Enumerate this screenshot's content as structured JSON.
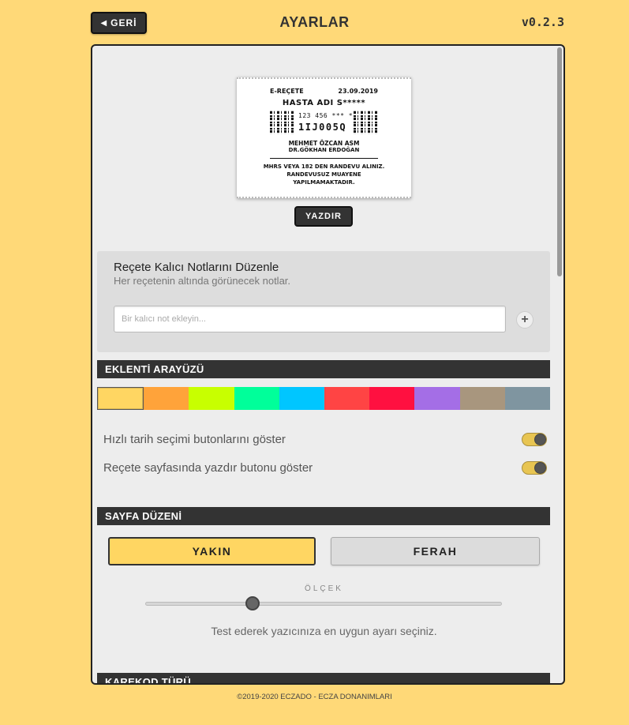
{
  "header": {
    "back_label": "GERİ",
    "title": "AYARLAR",
    "version": "v0.2.3"
  },
  "receipt": {
    "type": "E-REÇETE",
    "date": "23.09.2019",
    "patient": "HASTA ADI S*****",
    "code_small": "123 456 *** **",
    "code_big": "1IJ005Q",
    "organization": "MEHMET ÖZCAN ASM",
    "doctor": "DR.GÖKHAN ERDOĞAN",
    "note": "MHRS VEYA 182 DEN RANDEVU ALINIZ. RANDEVUSUZ MUAYENE YAPILMAMAKTADIR."
  },
  "print_label": "YAZDIR",
  "notes": {
    "title": "Reçete Kalıcı Notlarını Düzenle",
    "subtitle": "Her reçetenin altında görünecek notlar.",
    "placeholder": "Bir kalıcı not ekleyin...",
    "add_symbol": "+"
  },
  "plugin_section": {
    "title": "EKLENTİ ARAYÜZÜ",
    "swatches": [
      "#ffd662",
      "#ffa33a",
      "#c8ff00",
      "#00ff9a",
      "#00c6ff",
      "#ff4444",
      "#ff1040",
      "#a46ee6",
      "#a8967e",
      "#7f95a0"
    ],
    "selected_index": 0
  },
  "toggles": [
    {
      "label": "Hızlı tarih seçimi butonlarını göster",
      "on": true
    },
    {
      "label": "Reçete sayfasında yazdır butonu göster",
      "on": true
    }
  ],
  "layout_section": {
    "title": "SAYFA DÜZENİ",
    "options": [
      "YAKIN",
      "FERAH"
    ],
    "selected": "YAKIN",
    "scale_label": "ÖLÇEK",
    "scale_value": 0.3,
    "hint": "Test ederek yazıcınıza en uygun ayarı seçiniz."
  },
  "barcode_section": {
    "title": "KAREKOD TÜRÜ"
  },
  "footer": "©2019-2020 ECZADO - ECZA DONANIMLARI"
}
